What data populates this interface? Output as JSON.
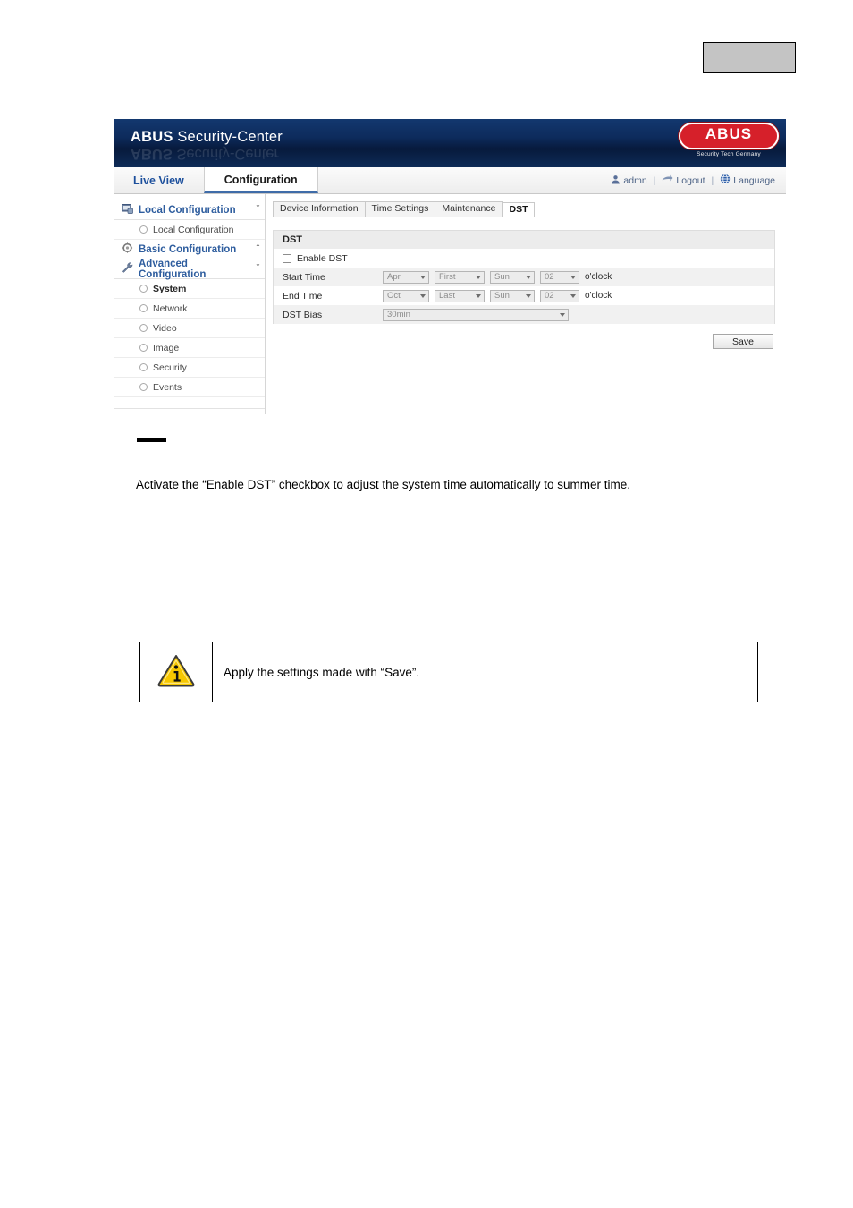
{
  "page": {
    "top_placeholder": "",
    "redacted_heading": "",
    "paragraph": "Activate the “Enable DST” checkbox to adjust the system time automatically to summer time.",
    "note": {
      "icon": "warning-info-triangle-icon",
      "text": "Apply the settings made with “Save”."
    }
  },
  "app": {
    "brand_bold": "ABUS",
    "brand_light": " Security-Center",
    "logo": {
      "word": "ABUS",
      "tagline": "Security Tech Germany",
      "color": "#d6202a"
    },
    "nav": {
      "tabs": [
        {
          "label": "Live View",
          "active": false
        },
        {
          "label": "Configuration",
          "active": true
        }
      ],
      "user": "admn",
      "user_icon": "user-icon",
      "logout": "Logout",
      "logout_icon": "logout-arrow-icon",
      "language": "Language",
      "language_icon": "globe-icon",
      "separator": "|"
    },
    "sidebar": {
      "groups": [
        {
          "label": "Local Configuration",
          "icon": "monitor-icon",
          "caret": "ˇ",
          "items": [
            {
              "label": "Local Configuration",
              "bold": false
            }
          ]
        },
        {
          "label": "Basic Configuration",
          "icon": "gear-icon",
          "caret": "ˆ",
          "items": []
        },
        {
          "label": "Advanced Configuration",
          "icon": "wrench-icon",
          "caret": "ˇ",
          "items": [
            {
              "label": "System",
              "bold": true
            },
            {
              "label": "Network",
              "bold": false
            },
            {
              "label": "Video",
              "bold": false
            },
            {
              "label": "Image",
              "bold": false
            },
            {
              "label": "Security",
              "bold": false
            },
            {
              "label": "Events",
              "bold": false
            }
          ]
        }
      ]
    },
    "content": {
      "tabs": [
        {
          "label": "Device Information",
          "active": false
        },
        {
          "label": "Time Settings",
          "active": false
        },
        {
          "label": "Maintenance",
          "active": false
        },
        {
          "label": "DST",
          "active": true
        }
      ],
      "panel_title": "DST",
      "enable_dst": {
        "label": "Enable DST",
        "checked": false
      },
      "start_time": {
        "label": "Start Time",
        "month": "Apr",
        "ordinal": "First",
        "weekday": "Sun",
        "hour": "02",
        "suffix": "o'clock"
      },
      "end_time": {
        "label": "End Time",
        "month": "Oct",
        "ordinal": "Last",
        "weekday": "Sun",
        "hour": "02",
        "suffix": "o'clock"
      },
      "dst_bias": {
        "label": "DST Bias",
        "value": "30min"
      },
      "save_label": "Save"
    }
  }
}
